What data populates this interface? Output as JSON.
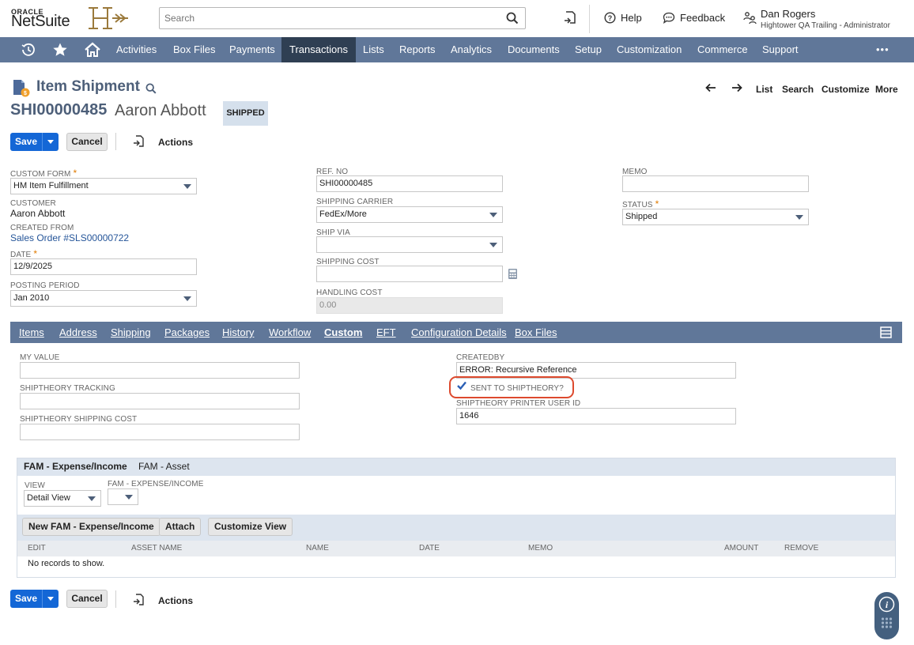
{
  "header": {
    "logo_top": "ORACLE",
    "logo_bottom": "NetSuite",
    "search_placeholder": "Search",
    "help": "Help",
    "feedback": "Feedback",
    "user_name": "Dan Rogers",
    "user_role": "Hightower QA Trailing - Administrator"
  },
  "nav": {
    "items": [
      "Activities",
      "Box Files",
      "Payments",
      "Transactions",
      "Lists",
      "Reports",
      "Analytics",
      "Documents",
      "Setup",
      "Customization",
      "Commerce",
      "Support"
    ],
    "active": "Transactions",
    "more": "•••"
  },
  "page": {
    "title": "Item Shipment",
    "record_id": "SHI00000485",
    "record_name": "Aaron Abbott",
    "status_badge": "SHIPPED",
    "top_links": {
      "list": "List",
      "search": "Search",
      "customize": "Customize",
      "more": "More"
    }
  },
  "buttons": {
    "save": "Save",
    "cancel": "Cancel",
    "actions": "Actions"
  },
  "fields": {
    "custom_form": {
      "label": "CUSTOM FORM",
      "value": "HM Item Fulfillment"
    },
    "customer": {
      "label": "CUSTOMER",
      "value": "Aaron Abbott"
    },
    "created_from": {
      "label": "CREATED FROM",
      "value": "Sales Order #SLS00000722"
    },
    "date": {
      "label": "DATE",
      "value": "12/9/2025"
    },
    "posting_period": {
      "label": "POSTING PERIOD",
      "value": "Jan 2010"
    },
    "ref_no": {
      "label": "REF. NO",
      "value": "SHI00000485"
    },
    "shipping_carrier": {
      "label": "SHIPPING CARRIER",
      "value": "FedEx/More"
    },
    "ship_via": {
      "label": "SHIP VIA",
      "value": ""
    },
    "shipping_cost": {
      "label": "SHIPPING COST",
      "value": ""
    },
    "handling_cost": {
      "label": "HANDLING COST",
      "value": "0.00"
    },
    "memo": {
      "label": "MEMO",
      "value": ""
    },
    "status": {
      "label": "STATUS",
      "value": "Shipped"
    }
  },
  "subtabs": {
    "items": [
      "Items",
      "Address",
      "Shipping",
      "Packages",
      "History",
      "Workflow",
      "Custom",
      "EFT",
      "Configuration Details",
      "Box Files"
    ],
    "active": "Custom"
  },
  "custom": {
    "my_value": {
      "label": "MY VALUE",
      "value": ""
    },
    "shiptheory_tracking": {
      "label": "SHIPTHEORY TRACKING",
      "value": ""
    },
    "shiptheory_shipping_cost": {
      "label": "SHIPTHEORY SHIPPING COST",
      "value": ""
    },
    "createdby": {
      "label": "CREATEDBY",
      "value": "ERROR: Recursive Reference"
    },
    "sent_to_shiptheory": {
      "label": "SENT TO SHIPTHEORY?",
      "checked": true
    },
    "printer_user_id": {
      "label": "SHIPTHEORY PRINTER USER ID",
      "value": "1646"
    }
  },
  "fam": {
    "tabs": [
      "FAM - Expense/Income",
      "FAM - Asset"
    ],
    "view_label": "VIEW",
    "view_value": "Detail View",
    "expense_label": "FAM - EXPENSE/INCOME",
    "buttons": [
      "New FAM - Expense/Income",
      "Attach",
      "Customize View"
    ],
    "columns": [
      "EDIT",
      "ASSET NAME",
      "NAME",
      "DATE",
      "MEMO",
      "AMOUNT",
      "REMOVE"
    ],
    "empty": "No records to show."
  }
}
